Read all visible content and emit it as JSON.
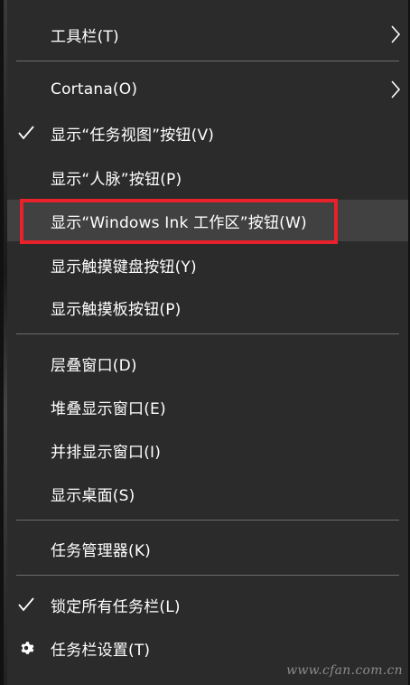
{
  "menu": {
    "items": [
      {
        "label": "工具栏(T)",
        "checked": false,
        "submenu": true,
        "icon": ""
      },
      {
        "label": "Cortana(O)",
        "checked": false,
        "submenu": true,
        "icon": ""
      },
      {
        "label": "显示“任务视图”按钮(V)",
        "checked": true,
        "submenu": false,
        "icon": "checkmark-icon"
      },
      {
        "label": "显示“人脉”按钮(P)",
        "checked": false,
        "submenu": false,
        "icon": ""
      },
      {
        "label": "显示“Windows Ink 工作区”按钮(W)",
        "checked": false,
        "submenu": false,
        "icon": "",
        "hovered": true
      },
      {
        "label": "显示触摸键盘按钮(Y)",
        "checked": false,
        "submenu": false,
        "icon": ""
      },
      {
        "label": "显示触摸板按钮(P)",
        "checked": false,
        "submenu": false,
        "icon": ""
      },
      {
        "label": "层叠窗口(D)",
        "checked": false,
        "submenu": false,
        "icon": ""
      },
      {
        "label": "堆叠显示窗口(E)",
        "checked": false,
        "submenu": false,
        "icon": ""
      },
      {
        "label": "并排显示窗口(I)",
        "checked": false,
        "submenu": false,
        "icon": ""
      },
      {
        "label": "显示桌面(S)",
        "checked": false,
        "submenu": false,
        "icon": ""
      },
      {
        "label": "任务管理器(K)",
        "checked": false,
        "submenu": false,
        "icon": ""
      },
      {
        "label": "锁定所有任务栏(L)",
        "checked": true,
        "submenu": false,
        "icon": "checkmark-icon"
      },
      {
        "label": "任务栏设置(T)",
        "checked": false,
        "submenu": false,
        "icon": "gear-icon"
      }
    ]
  },
  "colors": {
    "background": "#2b2b2b",
    "hover": "#414141",
    "separator": "#6b6b6b",
    "highlight_border": "#e8212b",
    "text": "#ffffff"
  },
  "watermark": "www.cfan.com.cn"
}
